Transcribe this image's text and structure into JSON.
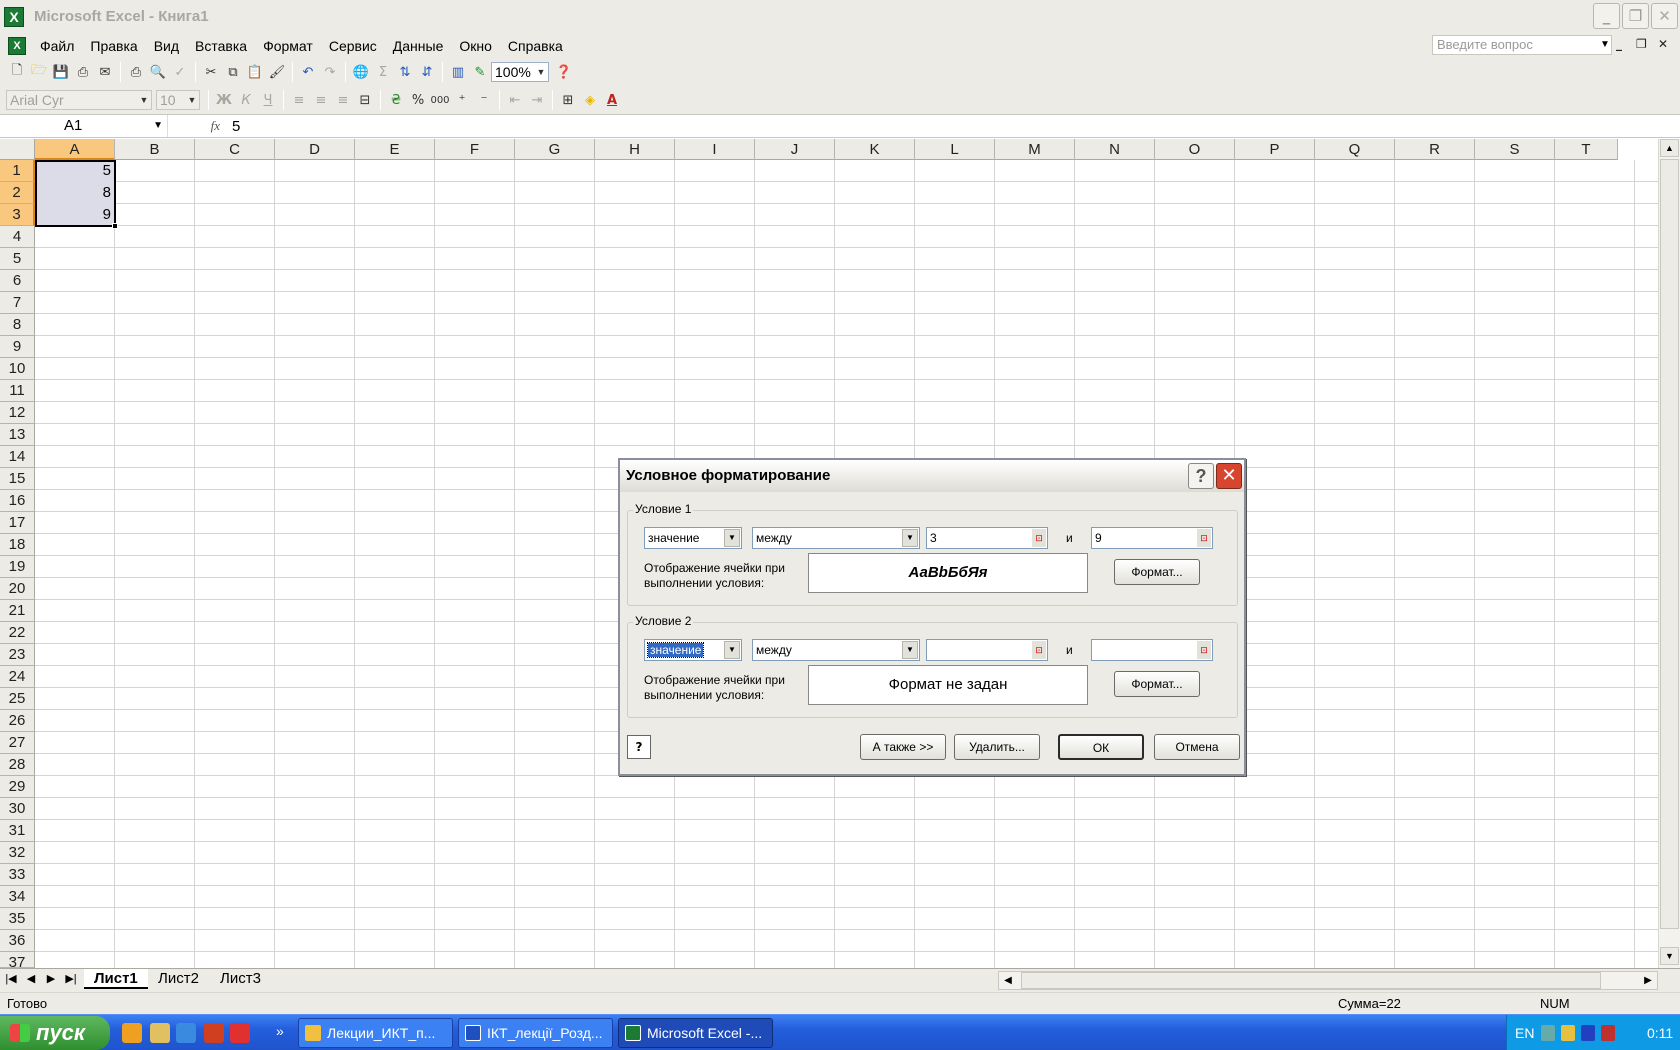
{
  "window": {
    "title": "Microsoft Excel - Книга1",
    "app_icon": "X"
  },
  "menubar": {
    "items": [
      "Файл",
      "Правка",
      "Вид",
      "Вставка",
      "Формат",
      "Сервис",
      "Данные",
      "Окно",
      "Справка"
    ],
    "ask_placeholder": "Введите вопрос"
  },
  "toolbar": {
    "zoom": "100%",
    "font_name": "Arial Cyr",
    "font_size": "10",
    "bold": "Ж",
    "italic": "К",
    "underline": "Ч",
    "percent": "%",
    "thousands": "000"
  },
  "formula_bar": {
    "name_box": "A1",
    "fx": "fx",
    "value": "5"
  },
  "columns": [
    "A",
    "B",
    "C",
    "D",
    "E",
    "F",
    "G",
    "H",
    "I",
    "J",
    "K",
    "L",
    "M",
    "N",
    "O",
    "P",
    "Q",
    "R",
    "S",
    "T"
  ],
  "rows": [
    "1",
    "2",
    "3",
    "4",
    "5",
    "6",
    "7",
    "8",
    "9",
    "10",
    "11",
    "12",
    "13",
    "14",
    "15",
    "16",
    "17",
    "18",
    "19",
    "20",
    "21",
    "22",
    "23",
    "24",
    "25",
    "26",
    "27",
    "28",
    "29",
    "30",
    "31",
    "32",
    "33",
    "34",
    "35",
    "36",
    "37"
  ],
  "cells": {
    "A1": "5",
    "A2": "8",
    "A3": "9"
  },
  "sheet_tabs": {
    "tabs": [
      "Лист1",
      "Лист2",
      "Лист3"
    ],
    "active": "Лист1"
  },
  "status_bar": {
    "ready": "Готово",
    "sum": "Сумма=22",
    "num": "NUM"
  },
  "dialog": {
    "title": "Условное форматирование",
    "condition1": {
      "legend": "Условие 1",
      "type": "значение",
      "operator": "между",
      "value1": "3",
      "and": "и",
      "value2": "9",
      "display_label_1": "Отображение ячейки при",
      "display_label_2": "выполнении условия:",
      "preview": "АаBbБбЯя",
      "format_button": "Формат..."
    },
    "condition2": {
      "legend": "Условие 2",
      "type": "значение",
      "operator": "между",
      "value1": "",
      "and": "и",
      "value2": "",
      "display_label_1": "Отображение ячейки при",
      "display_label_2": "выполнении условия:",
      "preview": "Формат не задан",
      "format_button": "Формат..."
    },
    "buttons": {
      "also": "А также >>",
      "delete": "Удалить...",
      "ok": "ОК",
      "cancel": "Отмена"
    }
  },
  "taskbar": {
    "start": "пуск",
    "tasks": [
      "Лекции_ИКТ_п...",
      "ІКТ_лекції_Розд...",
      "Microsoft Excel -..."
    ],
    "active_task": 2,
    "lang": "EN",
    "clock": "0:11"
  }
}
